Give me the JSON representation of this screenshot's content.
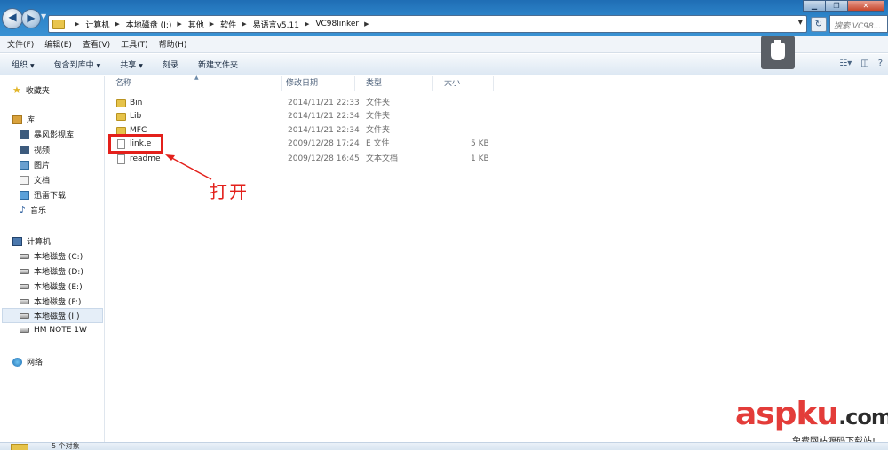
{
  "address": {
    "breadcrumbs": [
      "计算机",
      "本地磁盘 (I:)",
      "其他",
      "软件",
      "易语言v5.11",
      "VC98linker"
    ],
    "search_placeholder": "搜索 VC98..."
  },
  "menu": [
    "文件(F)",
    "编辑(E)",
    "查看(V)",
    "工具(T)",
    "帮助(H)"
  ],
  "commands": [
    {
      "label": "组织",
      "dropdown": true
    },
    {
      "label": "包含到库中",
      "dropdown": true
    },
    {
      "label": "共享",
      "dropdown": true
    },
    {
      "label": "刻录",
      "dropdown": false
    },
    {
      "label": "新建文件夹",
      "dropdown": false
    }
  ],
  "nav": {
    "favorites": "收藏夹",
    "library": "库",
    "library_items": [
      "暴风影视库",
      "视频",
      "图片",
      "文档",
      "迅雷下载",
      "音乐"
    ],
    "computer": "计算机",
    "drives": [
      "本地磁盘 (C:)",
      "本地磁盘 (D:)",
      "本地磁盘 (E:)",
      "本地磁盘 (F:)",
      "本地磁盘 (I:)",
      "HM NOTE 1W"
    ],
    "selected_drive": "本地磁盘 (I:)",
    "network": "网络"
  },
  "columns": {
    "name": "名称",
    "modified": "修改日期",
    "type": "类型",
    "size": "大小"
  },
  "files": [
    {
      "name": "Bin",
      "modified": "2014/11/21 22:33",
      "type": "文件夹",
      "size": "",
      "icon": "folder"
    },
    {
      "name": "Lib",
      "modified": "2014/11/21 22:34",
      "type": "文件夹",
      "size": "",
      "icon": "folder"
    },
    {
      "name": "MFC",
      "modified": "2014/11/21 22:34",
      "type": "文件夹",
      "size": "",
      "icon": "folder"
    },
    {
      "name": "link.e",
      "modified": "2009/12/28 17:24",
      "type": "E 文件",
      "size": "5 KB",
      "icon": "file"
    },
    {
      "name": "readme",
      "modified": "2009/12/28 16:45",
      "type": "文本文档",
      "size": "1 KB",
      "icon": "file"
    }
  ],
  "annotation": {
    "text": "打开",
    "color": "#e3201b"
  },
  "status": {
    "item_count": "5 个对象"
  },
  "watermark": {
    "brand": "aspku",
    "suffix": ".com",
    "subtitle": "免费网站源码下载站!"
  }
}
